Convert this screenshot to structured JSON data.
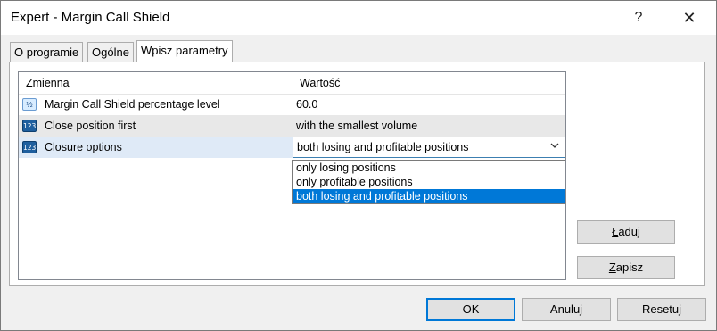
{
  "window": {
    "title": "Expert - Margin Call Shield",
    "help_label": "?",
    "close_label": "✕"
  },
  "tabs": [
    {
      "label": "O programie"
    },
    {
      "label": "Ogólne"
    },
    {
      "label": "Wpisz parametry"
    }
  ],
  "grid": {
    "columns": [
      "Zmienna",
      "Wartość"
    ],
    "rows": [
      {
        "icon": "fraction-icon",
        "icon_text": "½",
        "name": "Margin Call Shield percentage level",
        "value": "60.0"
      },
      {
        "icon": "number-icon",
        "icon_text": "123",
        "name": "Close position first",
        "value": "with the smallest volume"
      },
      {
        "icon": "number-icon",
        "icon_text": "123",
        "name": "Closure options",
        "value": "both losing and profitable positions"
      }
    ]
  },
  "dropdown": {
    "options": [
      "only losing positions",
      "only profitable positions",
      "both losing and profitable positions"
    ],
    "selected_index": 2
  },
  "buttons": {
    "load": {
      "first": "Ł",
      "rest": "aduj"
    },
    "save": {
      "first": "Z",
      "rest": "apisz"
    },
    "ok": "OK",
    "cancel": "Anuluj",
    "reset": "Resetuj"
  },
  "colors": {
    "accent": "#0078d7",
    "selected_row": "#dfeaf7",
    "alt_row": "#e8e8e8"
  }
}
